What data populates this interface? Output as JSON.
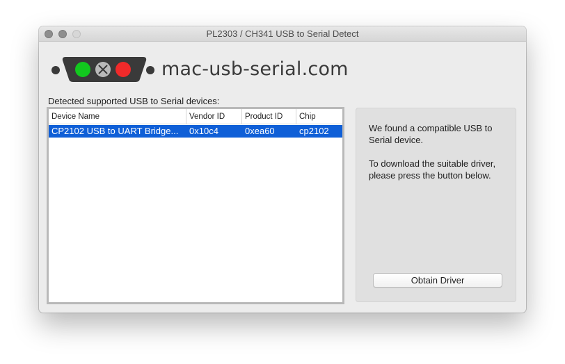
{
  "window": {
    "title": "PL2303 / CH341 USB to Serial Detect"
  },
  "logo": {
    "text": "mac-usb-serial.com",
    "colors": {
      "connector": "#3a3a3a",
      "green": "#12c81e",
      "gray": "#b9b9b9",
      "red": "#f02a2a"
    }
  },
  "list_label": "Detected supported USB to Serial devices:",
  "table": {
    "columns": [
      "Device Name",
      "Vendor ID",
      "Product ID",
      "Chip"
    ],
    "rows": [
      {
        "device_name": "CP2102 USB to UART Bridge...",
        "vendor_id": "0x10c4",
        "product_id": "0xea60",
        "chip": "cp2102",
        "selected": true
      }
    ],
    "selection_color": "#0f5fd7"
  },
  "info": {
    "line1": "We found a compatible USB to Serial device.",
    "line2": "To download the suitable driver, please press the button below."
  },
  "button": {
    "label": "Obtain Driver"
  }
}
